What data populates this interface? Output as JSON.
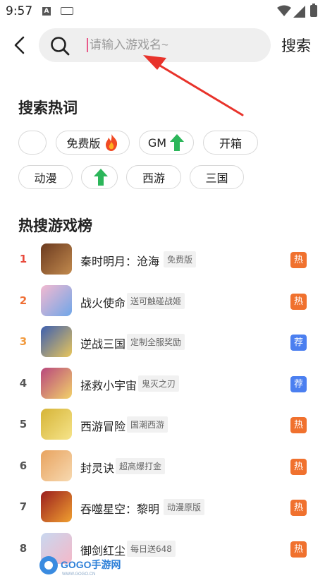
{
  "status_bar": {
    "time": "9:57",
    "a_glyph": "A"
  },
  "header": {
    "back_icon": "chevron-left-icon",
    "search_icon": "search-icon",
    "search_placeholder": "请输入游戏名~",
    "search_value": "",
    "search_button": "搜索"
  },
  "hot_section": {
    "title": "搜索热词",
    "chips": [
      {
        "label": "",
        "icon": ""
      },
      {
        "label": "免费版",
        "icon": "flame-icon"
      },
      {
        "label": "GM",
        "icon": "up-arrow-icon"
      },
      {
        "label": "开箱",
        "icon": ""
      },
      {
        "label": "动漫",
        "icon": ""
      },
      {
        "label": "",
        "icon": "up-arrow-icon"
      },
      {
        "label": "西游",
        "icon": ""
      },
      {
        "label": "三国",
        "icon": ""
      }
    ]
  },
  "rank_section": {
    "title": "热搜游戏榜",
    "items": [
      {
        "rank": "1",
        "name": "秦时明月：沧海",
        "tag": "免费版",
        "badge": "热",
        "rank_color": "#e84a3d",
        "badge_color": "#f0712e"
      },
      {
        "rank": "2",
        "name": "战火使命",
        "tag": "送可触碰战姬",
        "badge": "热",
        "rank_color": "#ef6f35",
        "badge_color": "#f0712e"
      },
      {
        "rank": "3",
        "name": "逆战三国",
        "tag": "定制全服奖励",
        "badge": "荐",
        "rank_color": "#f19a3e",
        "badge_color": "#4b7ff0"
      },
      {
        "rank": "4",
        "name": "拯救小宇宙",
        "tag": "鬼灭之刃",
        "badge": "荐",
        "rank_color": "#555555",
        "badge_color": "#4b7ff0"
      },
      {
        "rank": "5",
        "name": "西游冒险",
        "tag": "国潮西游",
        "badge": "热",
        "rank_color": "#555555",
        "badge_color": "#f0712e"
      },
      {
        "rank": "6",
        "name": "封灵诀",
        "tag": "超高爆打金",
        "badge": "热",
        "rank_color": "#555555",
        "badge_color": "#f0712e"
      },
      {
        "rank": "7",
        "name": "吞噬星空：黎明",
        "tag": "动漫原版",
        "badge": "热",
        "rank_color": "#555555",
        "badge_color": "#f0712e"
      },
      {
        "rank": "8",
        "name": "御剑红尘",
        "tag": "每日送648",
        "badge": "热",
        "rank_color": "#555555",
        "badge_color": "#f0712e"
      }
    ]
  },
  "watermark": {
    "text": "GOGO手游网",
    "subtext": "WWW.GOGO.CN"
  },
  "colors": {
    "accent_red": "#e8332b",
    "caret": "#e85a8a"
  }
}
